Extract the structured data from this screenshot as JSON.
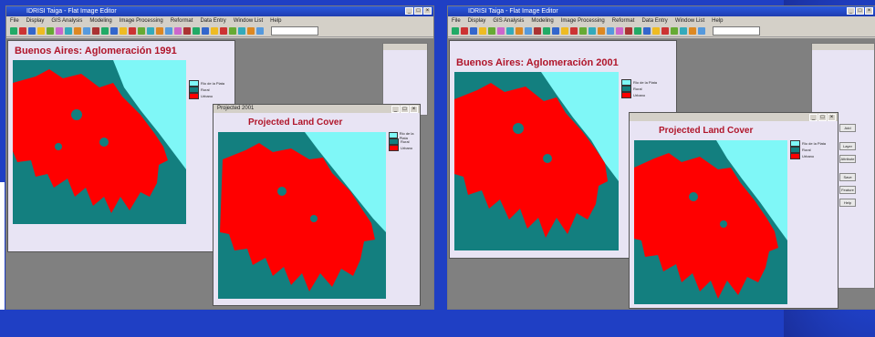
{
  "app_title": "IDRISI Taiga - Flat Image Editor",
  "menu": [
    "File",
    "Display",
    "GIS Analysis",
    "Modeling",
    "Image Processing",
    "Reformat",
    "Data Entry",
    "Window List",
    "Help"
  ],
  "toolbar_colors": [
    "#2a6",
    "#c33",
    "#36c",
    "#eb2",
    "#6a3",
    "#c6c",
    "#3ab",
    "#d82",
    "#59d",
    "#a33",
    "#2a6",
    "#36c",
    "#eb2",
    "#c33",
    "#6a3",
    "#3ab",
    "#d82",
    "#59d",
    "#c6c",
    "#a33",
    "#2a6",
    "#36c",
    "#eb2",
    "#c33",
    "#6a3",
    "#3ab",
    "#d82",
    "#59d"
  ],
  "left": {
    "map_title": "Buenos Aires: Aglomeración 1991",
    "projected_title": "Projected Land Cover",
    "projected_window_title": "Projected 2001"
  },
  "right": {
    "map_title": "Buenos Aires: Aglomeración 2001",
    "projected_title": "Projected Land Cover"
  },
  "legend": {
    "items": [
      {
        "label": "Rio de la Plata",
        "color": "#7ff7f7"
      },
      {
        "label": "Rural",
        "color": "#137f7f"
      },
      {
        "label": "Urbano",
        "color": "#ff0000"
      }
    ]
  },
  "side_buttons": [
    "Add",
    "Layer",
    "Attribute",
    "Save",
    "Feature",
    "Help"
  ],
  "colors": {
    "water": "#7ff7f7",
    "rural": "#137f7f",
    "urban": "#ff0000",
    "title_red": "#b0152a"
  }
}
